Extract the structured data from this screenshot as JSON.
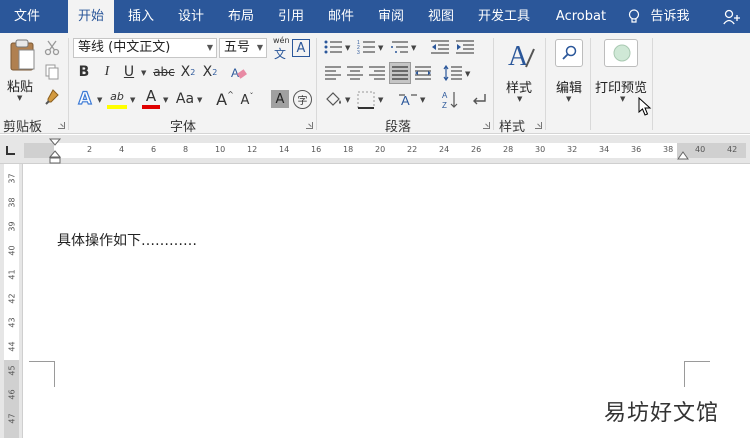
{
  "tabs": {
    "file": "文件",
    "home": "开始",
    "insert": "插入",
    "design": "设计",
    "layout": "布局",
    "references": "引用",
    "mailings": "邮件",
    "review": "审阅",
    "view": "视图",
    "developer": "开发工具",
    "acrobat": "Acrobat",
    "tell_me": "告诉我"
  },
  "clipboard": {
    "paste_label": "粘贴",
    "group_label": "剪贴板"
  },
  "font": {
    "font_name": "等线 (中文正文)",
    "font_size": "五号",
    "phonetic_top": "wén",
    "phonetic_bottom": "文",
    "char_border": "A",
    "bold": "B",
    "italic": "I",
    "underline": "U",
    "strikethrough": "abc",
    "subscript_base": "X",
    "subscript_sub": "2",
    "superscript_base": "X",
    "superscript_sup": "2",
    "text_effects": "A",
    "highlight": "ab",
    "font_color": "A",
    "change_case": "Aa",
    "grow": "A",
    "shrink": "A",
    "char_shading": "A",
    "enclose": "字",
    "group_label": "字体",
    "highlight_color": "#ffff00",
    "font_color_value": "#e00000"
  },
  "paragraph": {
    "group_label": "段落"
  },
  "styles": {
    "styles_label": "样式",
    "group_label": "样式"
  },
  "editing": {
    "label": "编辑"
  },
  "print_preview": {
    "label": "打印预览"
  },
  "ruler": {
    "marks": [
      "2",
      "4",
      "6",
      "8",
      "10",
      "12",
      "14",
      "16",
      "18",
      "20",
      "22",
      "24",
      "26",
      "28",
      "30",
      "32",
      "34",
      "36",
      "38",
      "40",
      "42"
    ]
  },
  "vruler": {
    "marks": [
      "37",
      "38",
      "39",
      "40",
      "41",
      "42",
      "43",
      "44",
      "45",
      "46",
      "47"
    ]
  },
  "document": {
    "text": "具体操作如下…………"
  },
  "watermark": "易坊好文馆",
  "colors": {
    "titlebar": "#2b579a",
    "ribbon": "#f3f3f3",
    "accent": "#2b579a"
  }
}
